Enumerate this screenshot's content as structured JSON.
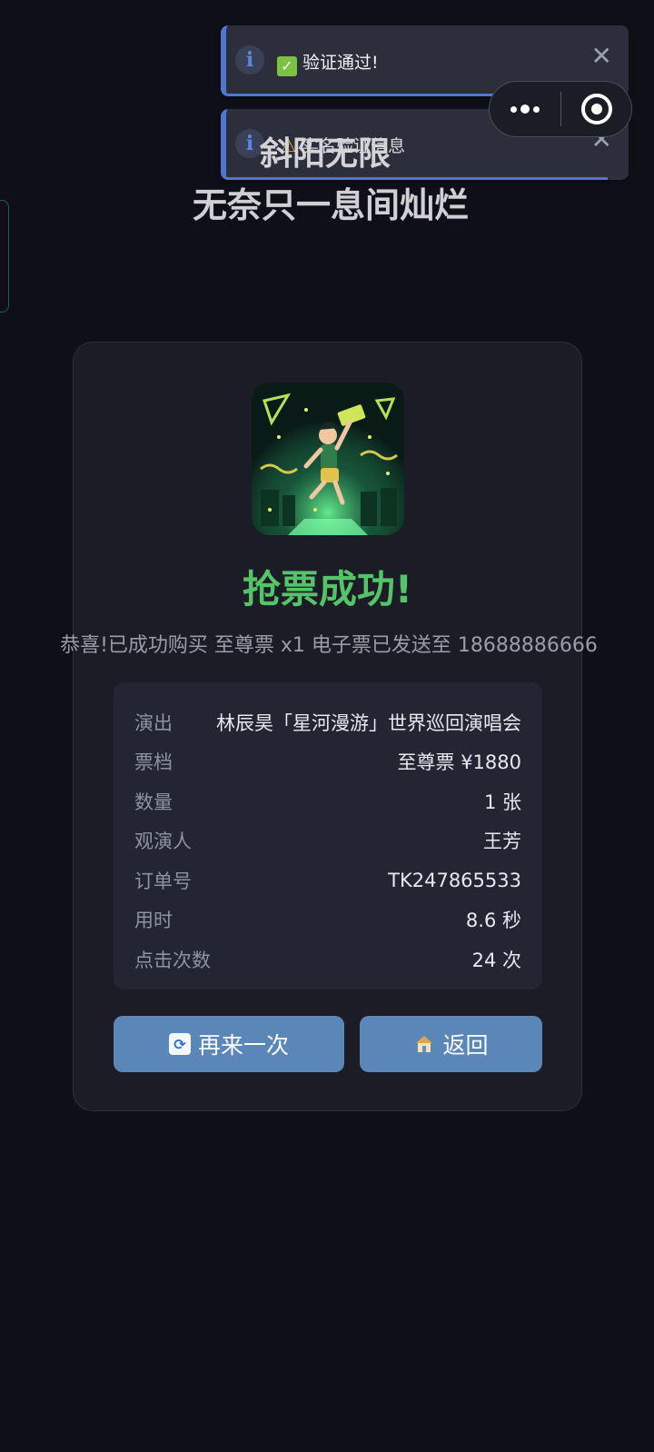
{
  "toasts": [
    {
      "text": "验证通过!",
      "icon": "info-icon",
      "prefix_icon": "check-icon"
    },
    {
      "text": "实名验证信息",
      "icon": "info-icon",
      "prefix_icon": "warning-icon"
    }
  ],
  "title": {
    "line1": "斜阳无限",
    "line2": "无奈只一息间灿烂"
  },
  "result": {
    "headline": "抢票成功!",
    "message": "恭喜!已成功购买 至尊票 x1 电子票已发送至 18688886666"
  },
  "details": [
    {
      "key": "演出",
      "value": "林辰昊「星河漫游」世界巡回演唱会"
    },
    {
      "key": "票档",
      "value": "至尊票 ¥1880"
    },
    {
      "key": "数量",
      "value": "1 张"
    },
    {
      "key": "观演人",
      "value": "王芳"
    },
    {
      "key": "订单号",
      "value": "TK247865533"
    },
    {
      "key": "用时",
      "value": "8.6 秒"
    },
    {
      "key": "点击次数",
      "value": "24 次"
    }
  ],
  "buttons": {
    "again": "再来一次",
    "back": "返回"
  },
  "colors": {
    "accent": "#5a86b8",
    "success": "#55c469",
    "toast_border": "#4f76d0"
  }
}
